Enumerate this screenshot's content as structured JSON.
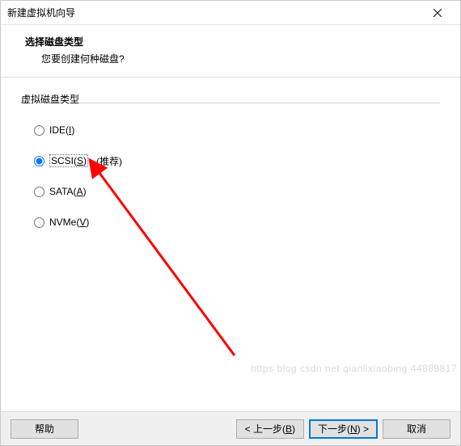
{
  "window": {
    "title": "新建虚拟机向导"
  },
  "header": {
    "title": "选择磁盘类型",
    "subtitle": "您要创建何种磁盘?"
  },
  "fieldset": {
    "legend": "虚拟磁盘类型"
  },
  "options": {
    "ide": {
      "label_prefix": "IDE(",
      "mnemonic": "I",
      "label_suffix": ")"
    },
    "scsi": {
      "label_prefix": "SCSI(",
      "mnemonic": "S",
      "label_suffix": ")",
      "recommend": "(推荐)"
    },
    "sata": {
      "label_prefix": "SATA(",
      "mnemonic": "A",
      "label_suffix": ")"
    },
    "nvme": {
      "label_prefix": "NVMe(",
      "mnemonic": "V",
      "label_suffix": ")"
    }
  },
  "footer": {
    "help": "帮助",
    "back_prefix": "< 上一步(",
    "back_mnemonic": "B",
    "back_suffix": ")",
    "next_prefix": "下一步(",
    "next_mnemonic": "N",
    "next_suffix": ") >",
    "cancel": "取消"
  },
  "watermark": "https blog csdn net qianlixiaobing 44889817"
}
